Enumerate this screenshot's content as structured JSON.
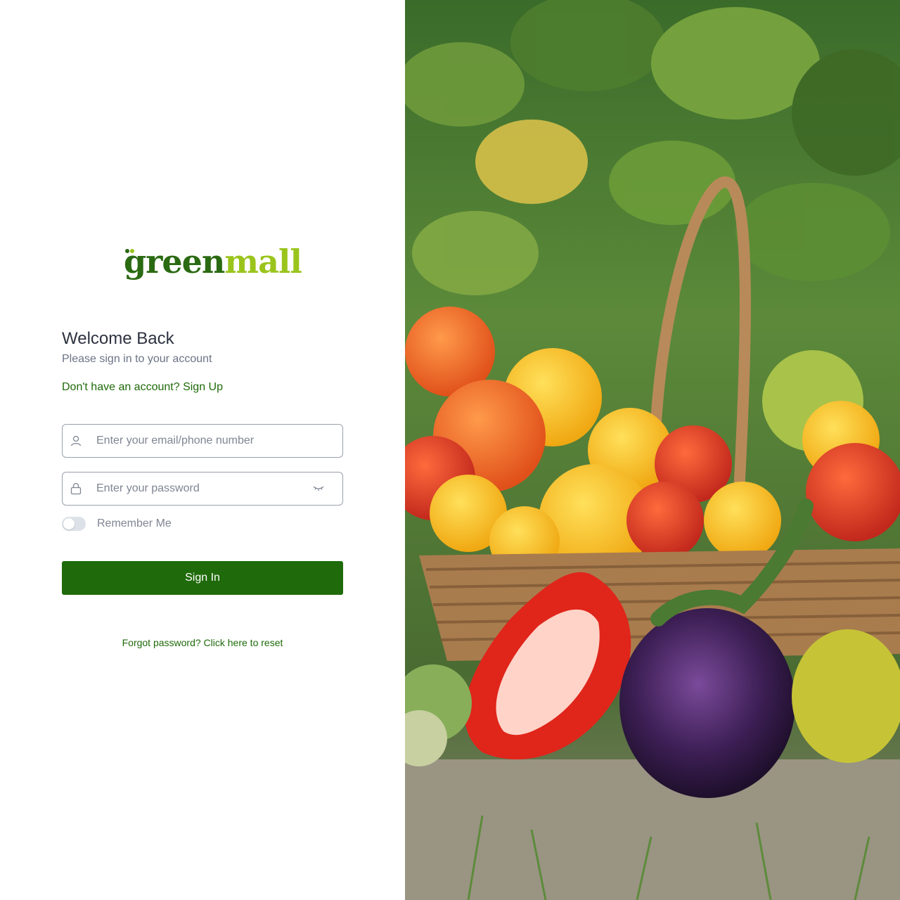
{
  "brand": {
    "name_part1": "green",
    "name_part2": "mall",
    "colors": {
      "dark_green": "#2a6a12",
      "lime": "#9ac41c"
    }
  },
  "login": {
    "title": "Welcome Back",
    "subtitle": "Please sign in to your account",
    "signup_link": "Don't have an account? Sign Up",
    "email_placeholder": "Enter your email/phone number",
    "password_placeholder": "Enter your password",
    "remember_label": "Remember Me",
    "remember_checked": false,
    "signin_label": "Sign In",
    "forgot_link": "Forgot password? Click here to reset"
  },
  "icons": {
    "email_field": "user-icon",
    "password_field": "lock-icon",
    "password_toggle": "eye-closed-icon"
  },
  "hero_image": {
    "subject": "basket of vegetables"
  },
  "theme": {
    "primary": "#1f6a0a",
    "text": "#2c3240",
    "muted": "#6b7385"
  }
}
